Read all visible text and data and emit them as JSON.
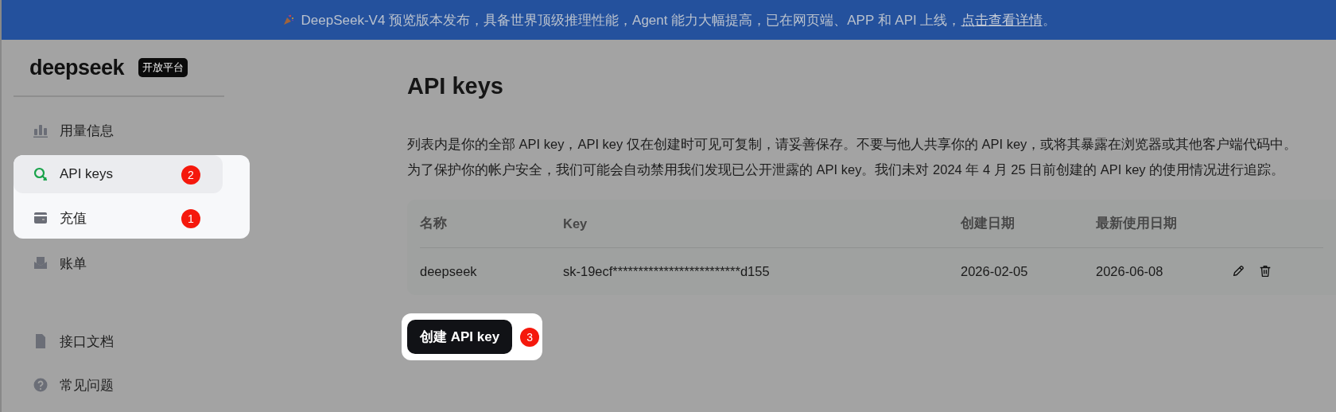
{
  "banner": {
    "text": "DeepSeek-V4 预览版本发布，具备世界顶级推理性能，Agent 能力大幅提高，已在网页端、APP 和 API 上线，",
    "link": "点击查看详情",
    "end": "。"
  },
  "logo": {
    "wordmark": "deepseek",
    "badge": "开放平台"
  },
  "sidebar": {
    "groups": [
      {
        "items": [
          {
            "label": "用量信息",
            "selected": false,
            "highlighted": false
          },
          {
            "label": "API keys",
            "selected": true,
            "highlighted": true,
            "step": "2"
          },
          {
            "label": "充值",
            "selected": false,
            "highlighted": true,
            "step": "1"
          },
          {
            "label": "账单",
            "selected": false,
            "highlighted": false
          }
        ]
      },
      {
        "items": [
          {
            "label": "接口文档",
            "selected": false,
            "highlighted": false
          },
          {
            "label": "常见问题",
            "selected": false,
            "highlighted": false
          }
        ]
      }
    ]
  },
  "page": {
    "title": "API keys",
    "description": [
      "列表内是你的全部 API key，API key 仅在创建时可见可复制，请妥善保存。不要与他人共享你的 API key，或将其暴露在浏览器或其他客户端代码中。",
      "为了保护你的帐户安全，我们可能会自动禁用我们发现已公开泄露的 API key。我们未对 2024 年 4 月 25 日前创建的 API key 的使用情况进行追踪。"
    ]
  },
  "table": {
    "columns": [
      "名称",
      "Key",
      "创建日期",
      "最新使用日期"
    ],
    "rows": [
      {
        "cells": [
          "deepseek",
          "sk-19ecf*************************d155",
          "2026-02-05",
          "2026-06-08"
        ]
      }
    ]
  },
  "create_button": {
    "label": "创建 API key",
    "highlighted": true,
    "step": "3"
  }
}
